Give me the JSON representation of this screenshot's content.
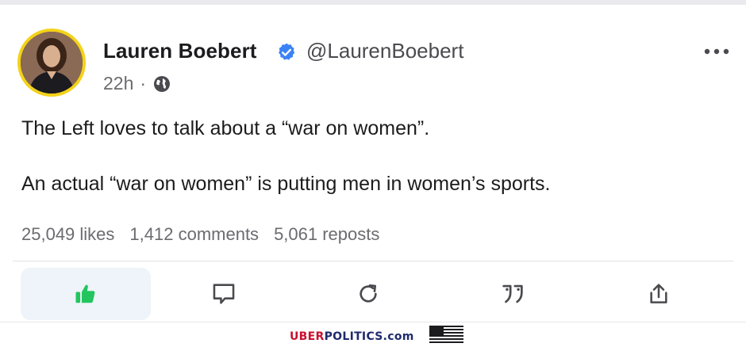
{
  "post": {
    "author_name": "Lauren Boebert",
    "handle": "@LaurenBoebert",
    "time": "22h",
    "separator": "·",
    "line1": "The Left loves to talk about a “war on women”.",
    "line2": "An actual “war on women” is putting men in women’s sports."
  },
  "stats": {
    "likes": "25,049 likes",
    "comments": "1,412 comments",
    "reposts": "5,061 reposts"
  },
  "icons": {
    "verified": "verified-badge-icon",
    "visibility": "globe-icon",
    "more": "more-dots-icon",
    "like": "thumbs-up-icon",
    "comment": "comment-icon",
    "repost": "repost-icon",
    "quote": "quote-icon",
    "share": "share-icon",
    "flag": "us-flag-icon"
  },
  "footer": {
    "brand_part1": "UBER",
    "brand_part2": "POLITICS.com"
  },
  "colors": {
    "verified": "#3b82f6",
    "like_active": "#22c55e",
    "avatar_ring": "#f3d21a",
    "brand_red": "#c8102e",
    "brand_blue": "#1f2a6b"
  }
}
